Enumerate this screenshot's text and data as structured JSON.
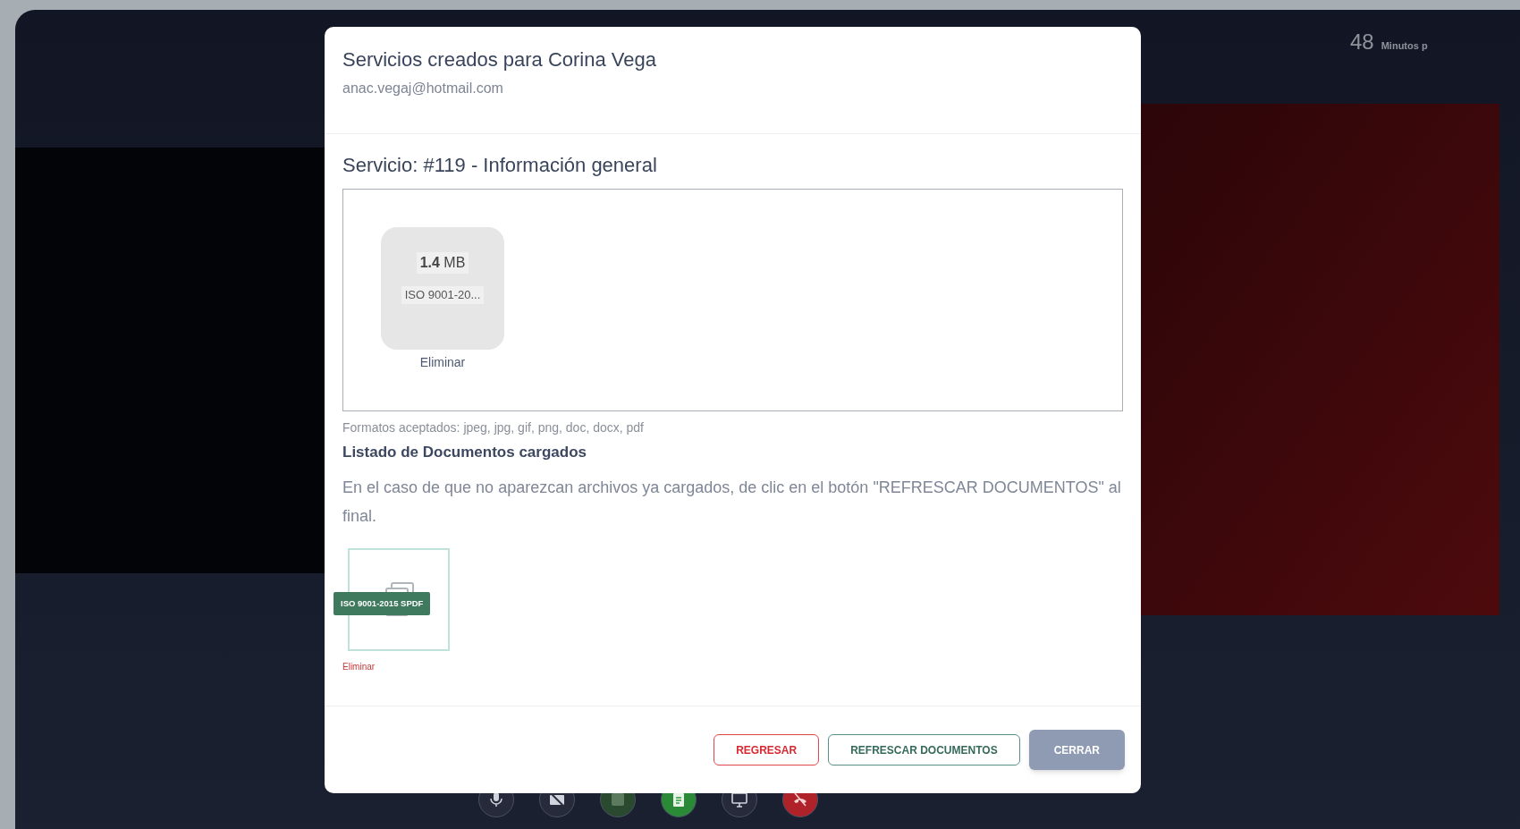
{
  "timer": {
    "value": "48",
    "label": "Minutos p"
  },
  "toolbar": [
    {
      "kind": "mic",
      "color": "#262a3a"
    },
    {
      "kind": "camera-off",
      "color": "#262a3a"
    },
    {
      "kind": "chat",
      "color": "#2a4a30"
    },
    {
      "kind": "document",
      "color": "#2a8a38"
    },
    {
      "kind": "screen",
      "color": "#262a3a"
    },
    {
      "kind": "hangup",
      "color": "#b0222a"
    }
  ],
  "modal": {
    "title": "Servicios creados para Corina Vega",
    "subtitle": "anac.vegaj@hotmail.com",
    "service_title": "Servicio: #119 - Información general",
    "upload_files": [
      {
        "size": "**1.4** MB",
        "name": "ISO 9001-20...",
        "action": "Eliminar"
      }
    ],
    "formats_note": "Formatos aceptados: jpeg, jpg, gif, png, doc, docx, pdf",
    "list_title": "Listado de Documentos cargados",
    "list_note": "En el caso de que no aparezcan archivos ya cargados, de clic en el botón \"REFRESCAR DOCUMENTOS\" al final.",
    "documents": [
      {
        "name": "ISO 9001-2015 SPDF",
        "action": "Eliminar"
      }
    ],
    "buttons": [
      {
        "label": "REGRESAR",
        "kind": "danger"
      },
      {
        "label": "REFRESCAR DOCUMENTOS",
        "kind": "outline"
      },
      {
        "label": "CERRAR",
        "kind": "primary"
      }
    ]
  }
}
